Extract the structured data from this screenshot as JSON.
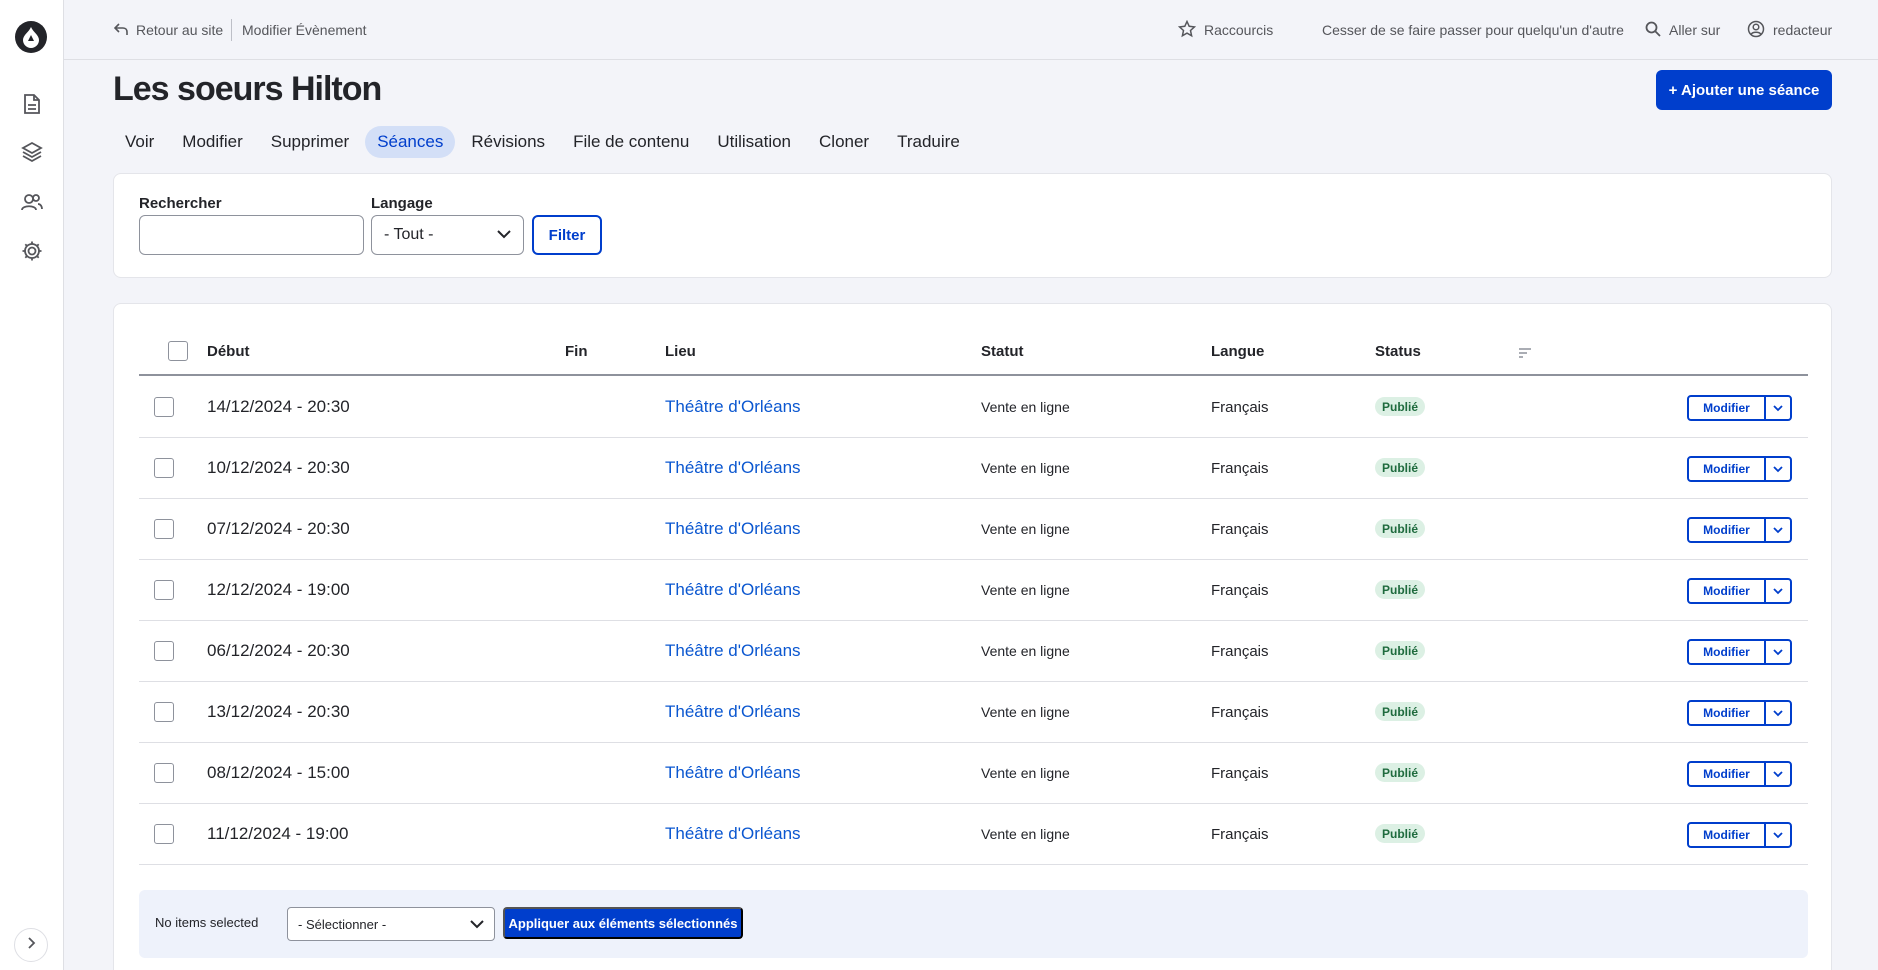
{
  "sidebar": {
    "logo_icon": "drupal-drop-icon",
    "items": [
      {
        "name": "content",
        "icon": "document-icon"
      },
      {
        "name": "structure",
        "icon": "layers-icon"
      },
      {
        "name": "people",
        "icon": "people-icon"
      },
      {
        "name": "configuration",
        "icon": "gear-icon"
      }
    ],
    "toggle_icon": "chevron-right-icon"
  },
  "topbar": {
    "back_label": "Retour au site",
    "edit_event_label": "Modifier Évènement",
    "shortcuts_label": "Raccourcis",
    "unmasquerade_label": "Cesser de se faire passer pour quelqu'un d'autre",
    "goto_label": "Aller sur",
    "user_label": "redacteur"
  },
  "page": {
    "title": "Les soeurs Hilton",
    "add_button": "+ Ajouter une séance",
    "accent_color": "#003ecc"
  },
  "tabs": [
    {
      "label": "Voir",
      "active": false
    },
    {
      "label": "Modifier",
      "active": false
    },
    {
      "label": "Supprimer",
      "active": false
    },
    {
      "label": "Séances",
      "active": true
    },
    {
      "label": "Révisions",
      "active": false
    },
    {
      "label": "File de contenu",
      "active": false
    },
    {
      "label": "Utilisation",
      "active": false
    },
    {
      "label": "Cloner",
      "active": false
    },
    {
      "label": "Traduire",
      "active": false
    }
  ],
  "filter": {
    "search_label": "Rechercher",
    "search_value": "",
    "language_label": "Langage",
    "language_value": "- Tout -",
    "filter_button": "Filter"
  },
  "table": {
    "headers": {
      "debut": "Début",
      "fin": "Fin",
      "lieu": "Lieu",
      "statut": "Statut",
      "langue": "Langue",
      "status": "Status"
    },
    "rows": [
      {
        "debut": "14/12/2024 - 20:30",
        "fin": "",
        "lieu": "Théâtre d'Orléans",
        "statut": "Vente en ligne",
        "langue": "Français",
        "status": "Publié",
        "action": "Modifier"
      },
      {
        "debut": "10/12/2024 - 20:30",
        "fin": "",
        "lieu": "Théâtre d'Orléans",
        "statut": "Vente en ligne",
        "langue": "Français",
        "status": "Publié",
        "action": "Modifier"
      },
      {
        "debut": "07/12/2024 - 20:30",
        "fin": "",
        "lieu": "Théâtre d'Orléans",
        "statut": "Vente en ligne",
        "langue": "Français",
        "status": "Publié",
        "action": "Modifier"
      },
      {
        "debut": "12/12/2024 - 19:00",
        "fin": "",
        "lieu": "Théâtre d'Orléans",
        "statut": "Vente en ligne",
        "langue": "Français",
        "status": "Publié",
        "action": "Modifier"
      },
      {
        "debut": "06/12/2024 - 20:30",
        "fin": "",
        "lieu": "Théâtre d'Orléans",
        "statut": "Vente en ligne",
        "langue": "Français",
        "status": "Publié",
        "action": "Modifier"
      },
      {
        "debut": "13/12/2024 - 20:30",
        "fin": "",
        "lieu": "Théâtre d'Orléans",
        "statut": "Vente en ligne",
        "langue": "Français",
        "status": "Publié",
        "action": "Modifier"
      },
      {
        "debut": "08/12/2024 - 15:00",
        "fin": "",
        "lieu": "Théâtre d'Orléans",
        "statut": "Vente en ligne",
        "langue": "Français",
        "status": "Publié",
        "action": "Modifier"
      },
      {
        "debut": "11/12/2024 - 19:00",
        "fin": "",
        "lieu": "Théâtre d'Orléans",
        "statut": "Vente en ligne",
        "langue": "Français",
        "status": "Publié",
        "action": "Modifier"
      }
    ]
  },
  "bulk": {
    "selected_text": "No items selected",
    "select_value": "- Sélectionner -",
    "apply_button": "Appliquer aux éléments sélectionnés"
  }
}
